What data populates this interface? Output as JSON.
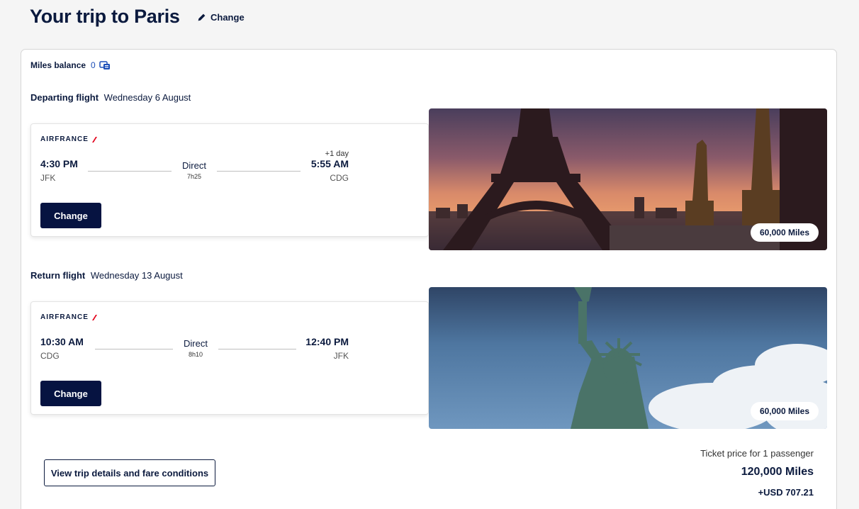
{
  "header": {
    "title": "Your trip to Paris",
    "change_label": "Change"
  },
  "miles_balance": {
    "label": "Miles balance",
    "value": "0"
  },
  "flights": [
    {
      "section_title": "Departing flight",
      "date": "Wednesday 6 August",
      "airline": "AIRFRANCE",
      "dep_time": "4:30 PM",
      "dep_code": "JFK",
      "arr_time": "5:55 AM",
      "arr_code": "CDG",
      "plus_day": "+1 day",
      "stops": "Direct",
      "duration": "7h25",
      "change_label": "Change",
      "miles": "60,000 Miles",
      "photo": "eiffel-tower-sunset"
    },
    {
      "section_title": "Return flight",
      "date": "Wednesday 13 August",
      "airline": "AIRFRANCE",
      "dep_time": "10:30 AM",
      "dep_code": "CDG",
      "arr_time": "12:40 PM",
      "arr_code": "JFK",
      "plus_day": "",
      "stops": "Direct",
      "duration": "8h10",
      "change_label": "Change",
      "miles": "60,000 Miles",
      "photo": "statue-of-liberty"
    }
  ],
  "footer": {
    "details_label": "View trip details and fare conditions",
    "price_label": "Ticket price for 1 passenger",
    "total_miles": "120,000 Miles",
    "total_usd": "+USD 707.21"
  },
  "colors": {
    "navy": "#061341",
    "text": "#0b1a3e",
    "accent_red": "#e3001b",
    "link_blue": "#1d4fb8"
  }
}
